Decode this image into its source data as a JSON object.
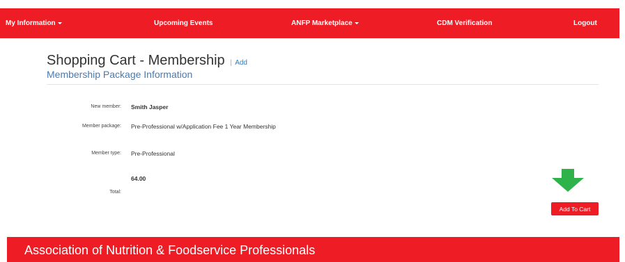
{
  "nav": {
    "my_information": "My Information",
    "upcoming_events": "Upcoming Events",
    "anfp_marketplace": "ANFP Marketplace",
    "cdm_verification": "CDM Verification",
    "logout": "Logout"
  },
  "page": {
    "title": "Shopping Cart - Membership",
    "separator": "|",
    "add_link": "Add",
    "subtitle": "Membership Package Information"
  },
  "form": {
    "new_member_label": "New member:",
    "new_member_value": "Smith Jasper",
    "member_package_label": "Member package:",
    "member_package_value": "Pre-Professional w/Application Fee 1 Year Membership",
    "member_type_label": "Member type:",
    "member_type_value": "Pre-Professional",
    "total_value": "64.00",
    "total_label": "Total:"
  },
  "actions": {
    "add_to_cart": "Add To Cart"
  },
  "footer": {
    "org_name": "Association of Nutrition & Foodservice Professionals"
  },
  "colors": {
    "brand_red": "#ee1c25",
    "arrow_green": "#2db34a",
    "link_blue": "#4a7ab0"
  },
  "icons": {
    "dropdown": "caret-down-icon",
    "arrow": "down-arrow-icon"
  }
}
